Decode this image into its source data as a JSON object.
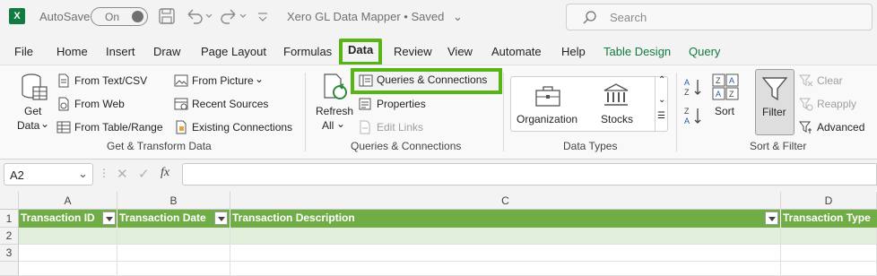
{
  "titlebar": {
    "app_logo": "X",
    "autosave_label": "AutoSave",
    "autosave_state": "On",
    "document_title": "Xero GL Data Mapper • Saved",
    "search_placeholder": "Search",
    "icons": [
      "save-icon",
      "undo-icon",
      "redo-icon",
      "customize-icon"
    ]
  },
  "tabs": [
    {
      "label": "File"
    },
    {
      "label": "Home"
    },
    {
      "label": "Insert"
    },
    {
      "label": "Draw"
    },
    {
      "label": "Page Layout"
    },
    {
      "label": "Formulas"
    },
    {
      "label": "Data"
    },
    {
      "label": "Review"
    },
    {
      "label": "View"
    },
    {
      "label": "Automate"
    },
    {
      "label": "Help"
    },
    {
      "label": "Table Design"
    },
    {
      "label": "Query"
    }
  ],
  "ribbon": {
    "get_transform": {
      "get_data_line1": "Get",
      "get_data_line2": "Data",
      "from_text_csv": "From Text/CSV",
      "from_web": "From Web",
      "from_table_range": "From Table/Range",
      "from_picture": "From Picture",
      "recent_sources": "Recent Sources",
      "existing_connections": "Existing Connections",
      "group_label": "Get & Transform Data"
    },
    "queries": {
      "refresh_line1": "Refresh",
      "refresh_line2": "All",
      "queries_connections": "Queries & Connections",
      "properties": "Properties",
      "edit_links": "Edit Links",
      "group_label": "Queries & Connections"
    },
    "data_types": {
      "organization": "Organization",
      "stocks": "Stocks",
      "group_label": "Data Types"
    },
    "sort_filter": {
      "sort": "Sort",
      "filter": "Filter",
      "clear": "Clear",
      "reapply": "Reapply",
      "advanced": "Advanced",
      "group_label": "Sort & Filter"
    }
  },
  "formula_bar": {
    "name_box": "A2",
    "fx": "fx",
    "formula": ""
  },
  "grid": {
    "columns": [
      "A",
      "B",
      "C",
      "D"
    ],
    "rows": [
      "1",
      "2",
      "3"
    ],
    "headers": [
      "Transaction ID",
      "Transaction Date",
      "Transaction Description",
      "Transaction Type"
    ]
  },
  "colors": {
    "excel_green": "#107c41",
    "highlight_green": "#58b515",
    "table_header": "#70ad47",
    "table_band": "#e2efda"
  }
}
